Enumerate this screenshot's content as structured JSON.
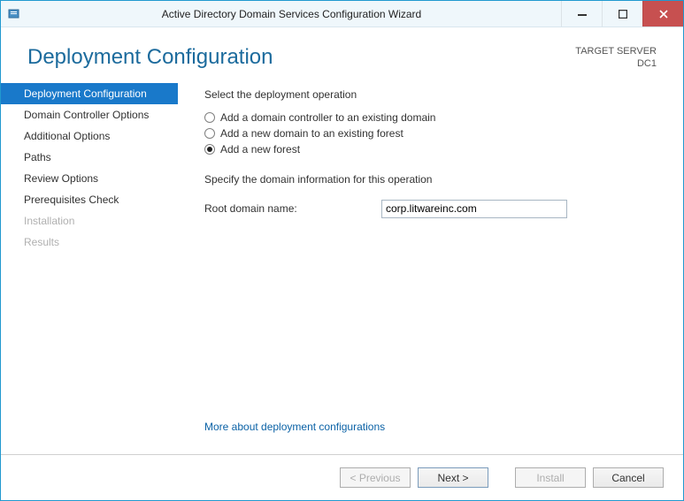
{
  "window": {
    "title": "Active Directory Domain Services Configuration Wizard"
  },
  "header": {
    "page_title": "Deployment Configuration",
    "target_label": "TARGET SERVER",
    "target_value": "DC1"
  },
  "nav": {
    "items": [
      {
        "label": "Deployment Configuration",
        "state": "active"
      },
      {
        "label": "Domain Controller Options",
        "state": "enabled"
      },
      {
        "label": "Additional Options",
        "state": "enabled"
      },
      {
        "label": "Paths",
        "state": "enabled"
      },
      {
        "label": "Review Options",
        "state": "enabled"
      },
      {
        "label": "Prerequisites Check",
        "state": "enabled"
      },
      {
        "label": "Installation",
        "state": "disabled"
      },
      {
        "label": "Results",
        "state": "disabled"
      }
    ]
  },
  "content": {
    "operation_label": "Select the deployment operation",
    "operations": [
      {
        "label": "Add a domain controller to an existing domain",
        "selected": false
      },
      {
        "label": "Add a new domain to an existing forest",
        "selected": false
      },
      {
        "label": "Add a new forest",
        "selected": true
      }
    ],
    "domain_info_label": "Specify the domain information for this operation",
    "root_domain_label": "Root domain name:",
    "root_domain_value": "corp.litwareinc.com",
    "help_link": "More about deployment configurations"
  },
  "footer": {
    "previous": "< Previous",
    "next": "Next >",
    "install": "Install",
    "cancel": "Cancel"
  }
}
